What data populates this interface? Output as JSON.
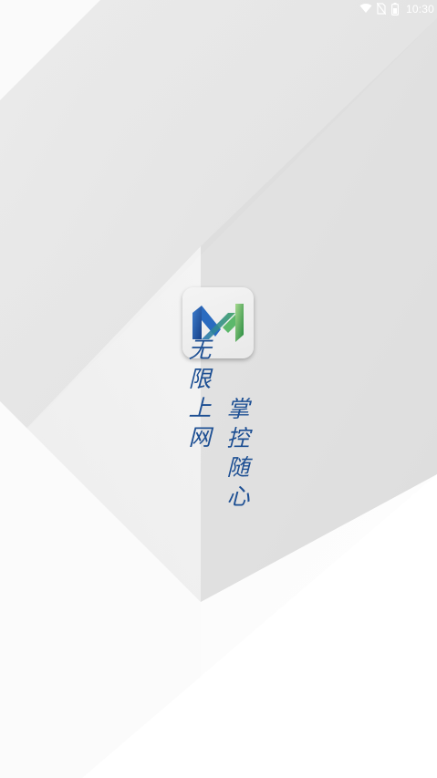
{
  "status_bar": {
    "time": "10:30",
    "icons": [
      "wifi-icon",
      "no-sim-icon",
      "battery-icon"
    ]
  },
  "app_icon": {
    "name": "app-logo",
    "colors": {
      "blue": "#1f63b3",
      "green": "#2f9e48",
      "light_green": "#7cc57f"
    }
  },
  "slogan": {
    "left": "无限上网",
    "right": "掌控随心"
  },
  "colors": {
    "slogan_text": "#1d4f93",
    "background": "#ececec"
  }
}
